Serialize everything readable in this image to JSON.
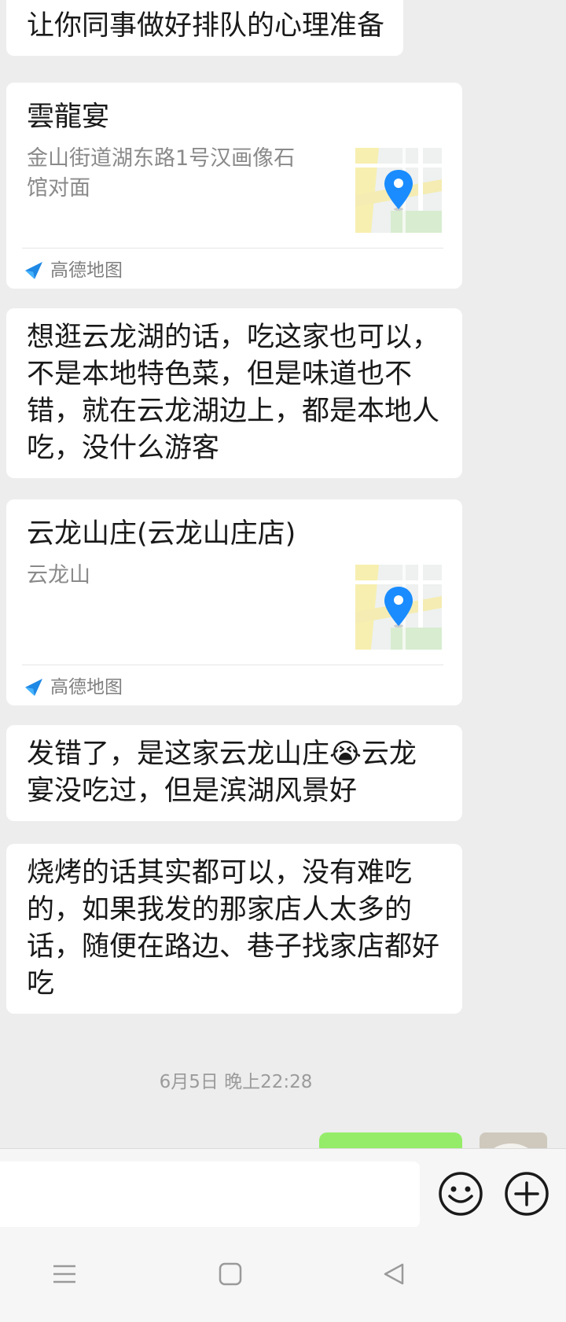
{
  "messages": {
    "m0_text": "让你同事做好排队的心理准备",
    "loc1": {
      "name": "雲龍宴",
      "address": "金山街道湖东路1号汉画像石馆对面",
      "source": "高德地图"
    },
    "m2_text": "想逛云龙湖的话，吃这家也可以，不是本地特色菜，但是味道也不错，就在云龙湖边上，都是本地人吃，没什么游客",
    "loc2": {
      "name": "云龙山庄(云龙山庄店)",
      "address": "云龙山",
      "source": "高德地图"
    },
    "m4_text_a": "发错了，是这家云龙山庄",
    "m4_emoji": "😭",
    "m4_text_b": "云龙宴没吃过，但是滨湖风景好",
    "m5_text": "烧烤的话其实都可以，没有难吃的，如果我发的那家店人太多的话，随便在路边、巷子找家店都好吃"
  },
  "timestamp": "6月5日 晚上22:28",
  "input": {
    "placeholder": ""
  },
  "icons": {
    "map_pin": "map-pin-icon",
    "amap_logo": "amap-logo-icon",
    "emoji_button": "emoji-icon",
    "plus_button": "plus-icon",
    "nav_menu": "menu-icon",
    "nav_home": "home-icon",
    "nav_back": "back-icon"
  },
  "colors": {
    "background": "#ededed",
    "bubble_incoming": "#ffffff",
    "bubble_outgoing": "#95ec69",
    "pin_blue": "#1a8cff",
    "secondary_text": "#8a8a8a"
  }
}
